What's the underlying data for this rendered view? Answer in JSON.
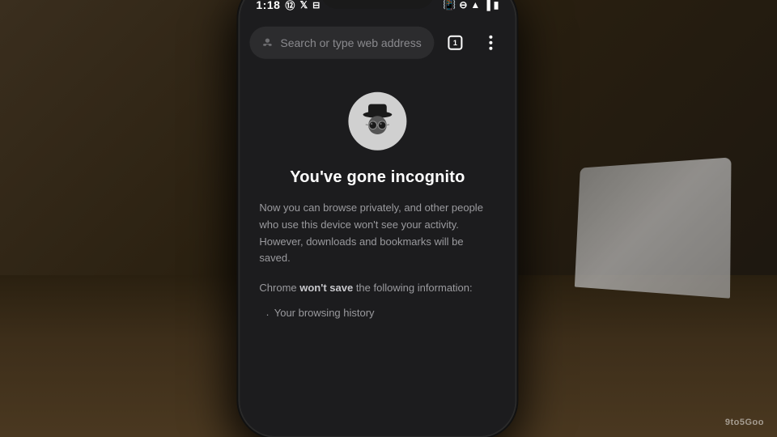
{
  "scene": {
    "background_color": "#2a2218"
  },
  "status_bar": {
    "time": "1:18",
    "left_icons": [
      "spotify",
      "twitter",
      "cast"
    ],
    "right_icons": [
      "vibrate",
      "dnd",
      "wifi",
      "signal",
      "battery"
    ]
  },
  "address_bar": {
    "placeholder": "Search or type web address",
    "tab_count": "1"
  },
  "incognito_page": {
    "title": "You've gone incognito",
    "description": "Now you can browse privately, and other people who use this device won't see your activity. However, downloads and bookmarks will be saved.",
    "chrome_info_prefix": "Chrome ",
    "chrome_info_bold": "won't save",
    "chrome_info_suffix": " the following information:",
    "bullet_items": [
      "Your browsing history"
    ]
  },
  "watermark": {
    "text": "9to5Goo"
  },
  "icons": {
    "incognito_small": "🕵",
    "menu_dots": "⋮",
    "tab_icon": "⬜"
  }
}
